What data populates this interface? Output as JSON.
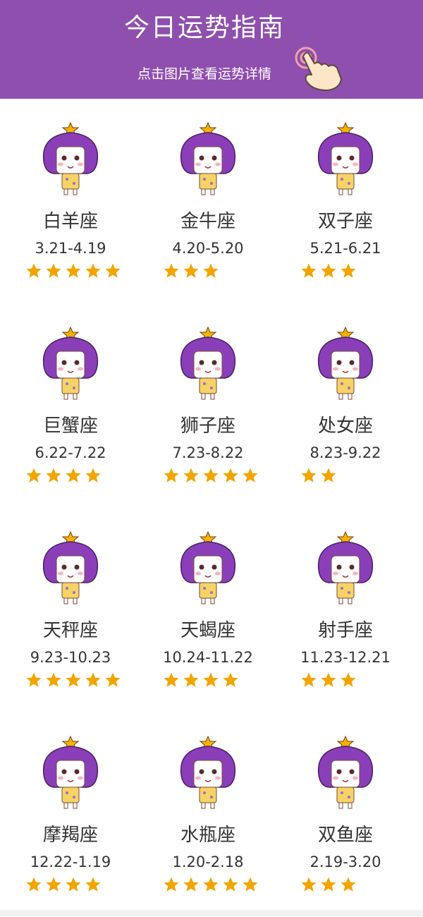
{
  "header": {
    "title": "今日运势指南",
    "subtitle": "点击图片查看运势详情",
    "background": "#8e4fae",
    "icon": "tap-hand-icon"
  },
  "colors": {
    "star": "#f2a500",
    "hair": "#8a3fb8",
    "hair_star": "#f5b400",
    "text": "#333333"
  },
  "signs": [
    {
      "name": "白羊座",
      "dates": "3.21-4.19",
      "stars": 5,
      "icon": "aries-avatar-icon"
    },
    {
      "name": "金牛座",
      "dates": "4.20-5.20",
      "stars": 3,
      "icon": "taurus-avatar-icon"
    },
    {
      "name": "双子座",
      "dates": "5.21-6.21",
      "stars": 3,
      "icon": "gemini-avatar-icon"
    },
    {
      "name": "巨蟹座",
      "dates": "6.22-7.22",
      "stars": 4,
      "icon": "cancer-avatar-icon"
    },
    {
      "name": "狮子座",
      "dates": "7.23-8.22",
      "stars": 5,
      "icon": "leo-avatar-icon"
    },
    {
      "name": "处女座",
      "dates": "8.23-9.22",
      "stars": 2,
      "icon": "virgo-avatar-icon"
    },
    {
      "name": "天秤座",
      "dates": "9.23-10.23",
      "stars": 5,
      "icon": "libra-avatar-icon"
    },
    {
      "name": "天蝎座",
      "dates": "10.24-11.22",
      "stars": 4,
      "icon": "scorpio-avatar-icon"
    },
    {
      "name": "射手座",
      "dates": "11.23-12.21",
      "stars": 3,
      "icon": "sagittarius-avatar-icon"
    },
    {
      "name": "摩羯座",
      "dates": "12.22-1.19",
      "stars": 4,
      "icon": "capricorn-avatar-icon"
    },
    {
      "name": "水瓶座",
      "dates": "1.20-2.18",
      "stars": 5,
      "icon": "aquarius-avatar-icon"
    },
    {
      "name": "双鱼座",
      "dates": "2.19-3.20",
      "stars": 3,
      "icon": "pisces-avatar-icon"
    }
  ]
}
